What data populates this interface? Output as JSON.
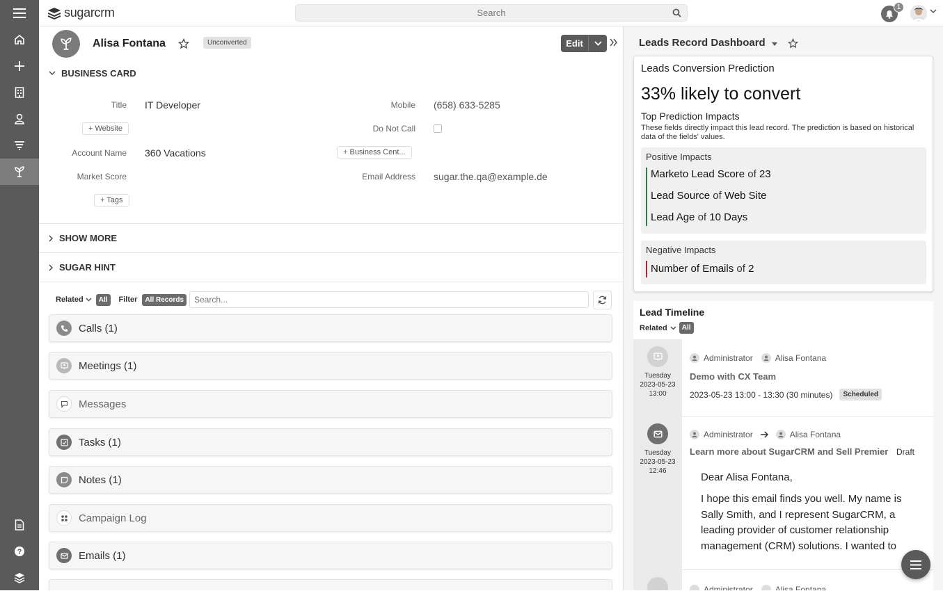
{
  "app": {
    "logo_text": "sugarcrm",
    "search_placeholder": "Search",
    "notification_count": "1"
  },
  "sidebar": {
    "items": [
      "menu-icon",
      "home-icon",
      "plus-icon",
      "accounts-icon",
      "contacts-icon",
      "leads-filter-icon",
      "leads-icon",
      "reports-icon",
      "help-icon",
      "layers-icon"
    ]
  },
  "record": {
    "name": "Alisa Fontana",
    "status_badge": "Unconverted",
    "edit_label": "Edit",
    "business_card_label": "BUSINESS CARD",
    "show_more_label": "SHOW MORE",
    "sugar_hint_label": "SUGAR HINT",
    "fields": {
      "title_label": "Title",
      "title_value": "IT Developer",
      "mobile_label": "Mobile",
      "mobile_value": "(658) 633-5285",
      "website_btn": "+ Website",
      "do_not_call_label": "Do Not Call",
      "account_label": "Account Name",
      "account_value": "360 Vacations",
      "business_center_btn": "+ Business Cent...",
      "market_score_label": "Market Score",
      "email_label": "Email Address",
      "email_value": "sugar.the.qa@example.de",
      "tags_btn": "+ Tags"
    }
  },
  "related": {
    "related_label": "Related",
    "all_pill": "All",
    "filter_label": "Filter",
    "all_records_pill": "All Records",
    "search_placeholder": "Search...",
    "subpanels": [
      {
        "label": "Calls (1)"
      },
      {
        "label": "Meetings (1)"
      },
      {
        "label": "Messages"
      },
      {
        "label": "Tasks (1)"
      },
      {
        "label": "Notes (1)"
      },
      {
        "label": "Campaign Log"
      },
      {
        "label": "Emails (1)"
      }
    ]
  },
  "dashboard": {
    "title": "Leads Record Dashboard",
    "prediction": {
      "title": "Leads Conversion Prediction",
      "percent_text": "33% likely to convert",
      "top_impacts_title": "Top Prediction Impacts",
      "description": "These fields directly impact this lead record. The prediction is based on historical data of the fields' values.",
      "positive_label": "Positive Impacts",
      "positive": [
        {
          "field": "Marketo Lead Score",
          "of": "of",
          "value": "23"
        },
        {
          "field": "Lead Source",
          "of": "of",
          "value": "Web Site"
        },
        {
          "field": "Lead Age",
          "of": "of",
          "value": "10 Days"
        }
      ],
      "negative_label": "Negative Impacts",
      "negative": [
        {
          "field": "Number of Emails",
          "of": "of",
          "value": "2"
        }
      ]
    },
    "timeline": {
      "title": "Lead Timeline",
      "related_label": "Related",
      "all_pill": "All",
      "entries": [
        {
          "day": "Tuesday",
          "date": "2023-05-23",
          "time": "13:00",
          "from": "Administrator",
          "to": "Alisa Fontana",
          "subject": "Demo with CX Team",
          "meta": "2023-05-23 13:00 - 13:30 (30 minutes)",
          "status": "Scheduled"
        },
        {
          "day": "Tuesday",
          "date": "2023-05-23",
          "time": "12:46",
          "from": "Administrator",
          "to": "Alisa Fontana",
          "subject": "Learn more about SugarCRM and Sell Premier",
          "status": "Draft",
          "greeting": "Dear Alisa Fontana,",
          "body": "I hope this email finds you well. My name is Sally Smith, and I represent SugarCRM, a leading provider of customer relationship management (CRM) solutions. I wanted to"
        },
        {
          "from": "Administrator",
          "to": "Alisa Fontana"
        }
      ]
    }
  },
  "colors": {
    "sidebar": "#5a5a5a",
    "positive": "#2e7d4f",
    "negative": "#a0283c",
    "accent_gray": "#6a6a6a"
  }
}
